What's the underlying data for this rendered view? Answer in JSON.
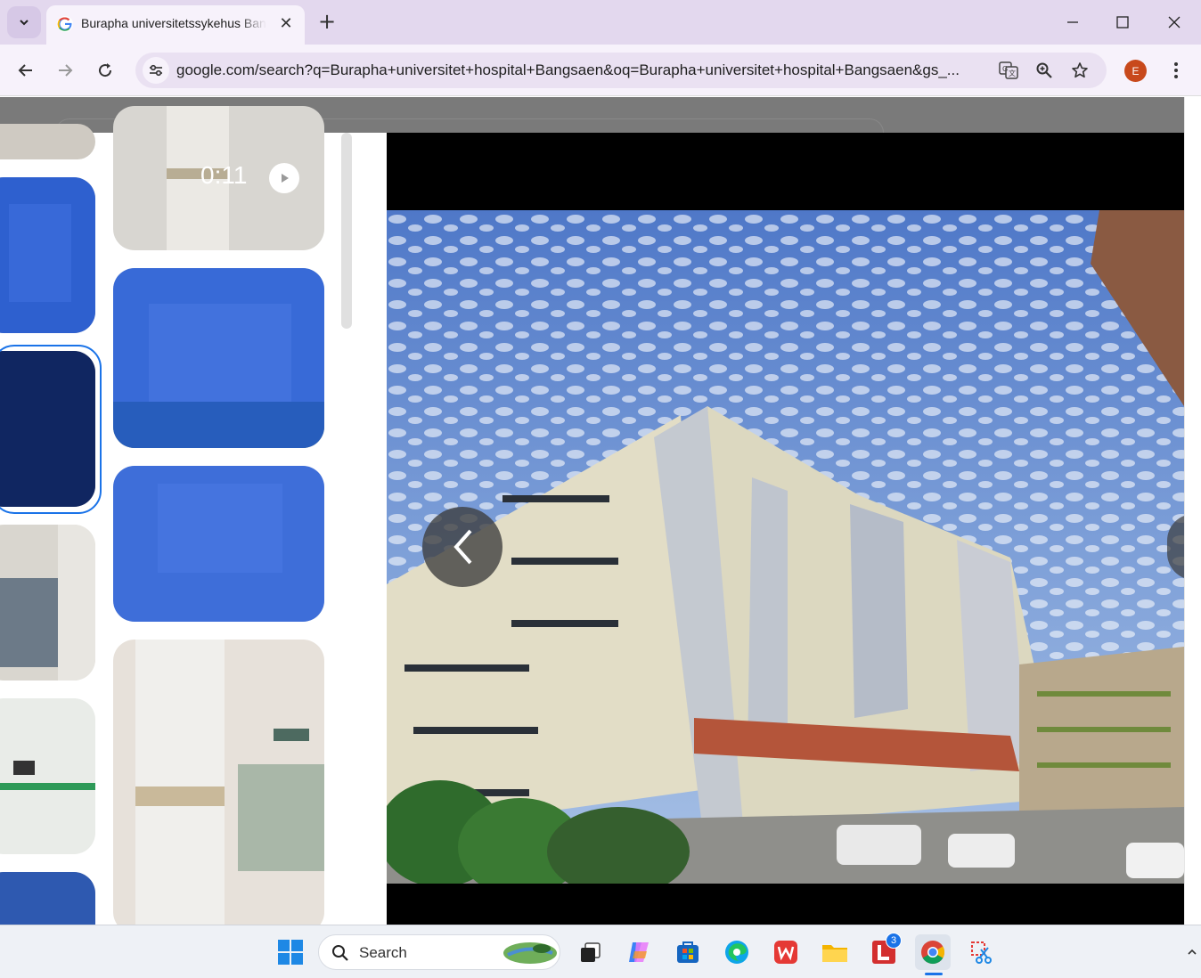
{
  "browser": {
    "tab_title": "Burapha universitetssykehus Bangsaen",
    "tab_close": "✕",
    "new_tab": "+",
    "url": "google.com/search?q=Burapha+universitet+hospital+Bangsaen&oq=Burapha+universitet+hospital+Bangsaen&gs_...",
    "profile_initial": "E"
  },
  "viewer": {
    "video_duration": "0:11"
  },
  "taskbar": {
    "search_label": "Search",
    "notification_count": "3"
  },
  "colors": {
    "tabbar_bg": "#e3d8ee",
    "toolbar_bg": "#f7f2fb",
    "thumb_overlay": "#1854dc",
    "selection_ring": "#1a73e8",
    "profile_avatar": "#c8491c"
  }
}
